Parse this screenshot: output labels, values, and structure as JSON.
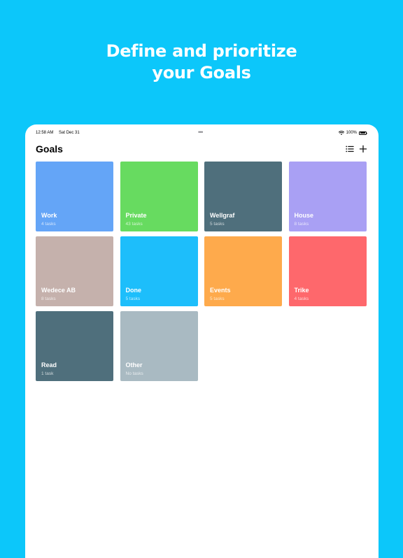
{
  "headline": {
    "line1": "Define and prioritize",
    "line2": "your Goals"
  },
  "status_bar": {
    "time": "12:58 AM",
    "date": "Sat Dec 31",
    "multitask_dots": "•••",
    "battery": "100%",
    "icons": [
      "wifi-icon",
      "battery-icon"
    ]
  },
  "header": {
    "title": "Goals",
    "list_icon": "list-icon",
    "add_icon": "plus-icon"
  },
  "goals": [
    {
      "name": "Work",
      "count": "4 tasks",
      "color": "#64A5F7"
    },
    {
      "name": "Private",
      "count": "43 tasks",
      "color": "#67DB60"
    },
    {
      "name": "Wellgraf",
      "count": "5 tasks",
      "color": "#4F6F7C"
    },
    {
      "name": "House",
      "count": "8 tasks",
      "color": "#A9A0F4"
    },
    {
      "name": "Wedece AB",
      "count": "8 tasks",
      "color": "#C5B1AC"
    },
    {
      "name": "Done",
      "count": "5 tasks",
      "color": "#1DBEFB"
    },
    {
      "name": "Events",
      "count": "5 tasks",
      "color": "#FEAA4C"
    },
    {
      "name": "Trike",
      "count": "4 tasks",
      "color": "#FE686C"
    },
    {
      "name": "Read",
      "count": "1 task",
      "color": "#4F6F7C"
    },
    {
      "name": "Other",
      "count": "No tasks",
      "color": "#A9BAC2"
    }
  ],
  "colors": {
    "background": "#0CC7FA",
    "headline": "#FFFFFF",
    "device": "#FFFFFF"
  }
}
